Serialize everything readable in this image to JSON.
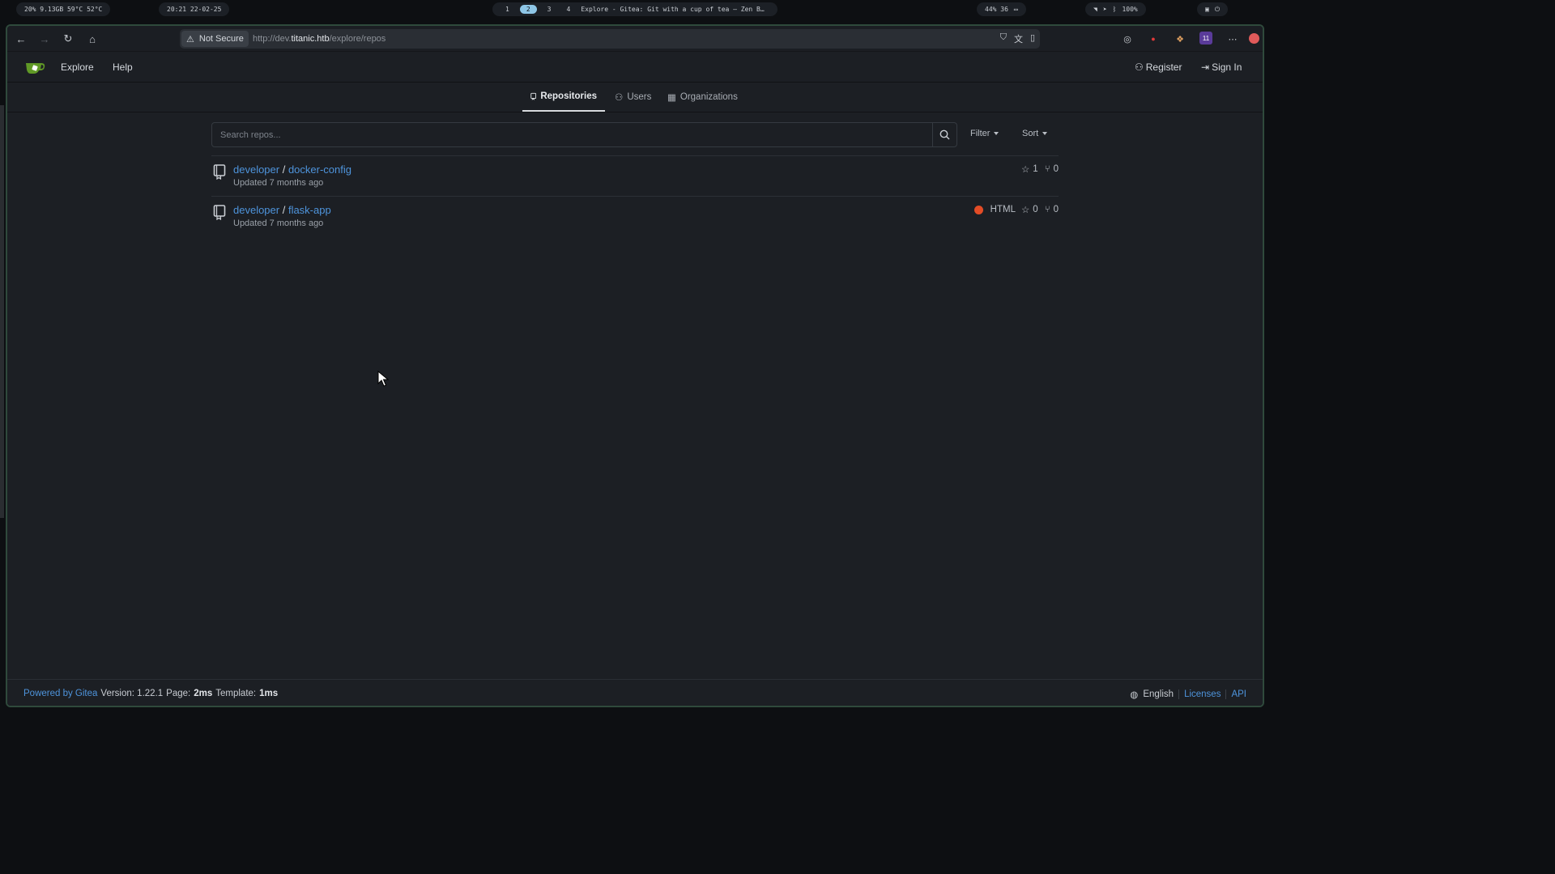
{
  "sysbar": {
    "stats": "20%  9.13GB  59°C  52°C",
    "datetime": "20:21  22-02-25",
    "workspaces": [
      "1",
      "2",
      "3",
      "4"
    ],
    "active_workspace": "2",
    "window_title": "Explore - Gitea: Git with a cup of tea — Zen B…",
    "media": "44%  36",
    "battery": "100%"
  },
  "browser": {
    "security_label": "Not Secure",
    "url_prefix": "http://dev.",
    "url_host": "titanic.htb",
    "url_path": "/explore/repos",
    "ext_badge": "11"
  },
  "navbar": {
    "explore": "Explore",
    "help": "Help",
    "register": "Register",
    "sign_in": "Sign In"
  },
  "tabs": {
    "repositories": "Repositories",
    "users": "Users",
    "organizations": "Organizations"
  },
  "search": {
    "placeholder": "Search repos...",
    "filter": "Filter",
    "sort": "Sort"
  },
  "repos": [
    {
      "owner": "developer",
      "name": "docker-config",
      "updated": "Updated 7 months ago",
      "language": "",
      "stars": "1",
      "forks": "0"
    },
    {
      "owner": "developer",
      "name": "flask-app",
      "updated": "Updated 7 months ago",
      "language": "HTML",
      "stars": "0",
      "forks": "0"
    }
  ],
  "footer": {
    "powered": "Powered by Gitea",
    "version": "Version: 1.22.1",
    "page_label": "Page:",
    "page_time": "2ms",
    "template_label": "Template:",
    "template_time": "1ms",
    "language": "English",
    "licenses": "Licenses",
    "api": "API"
  },
  "colors": {
    "link": "#4e94dc",
    "html_lang": "#e34c26",
    "background": "#1c1f24"
  }
}
